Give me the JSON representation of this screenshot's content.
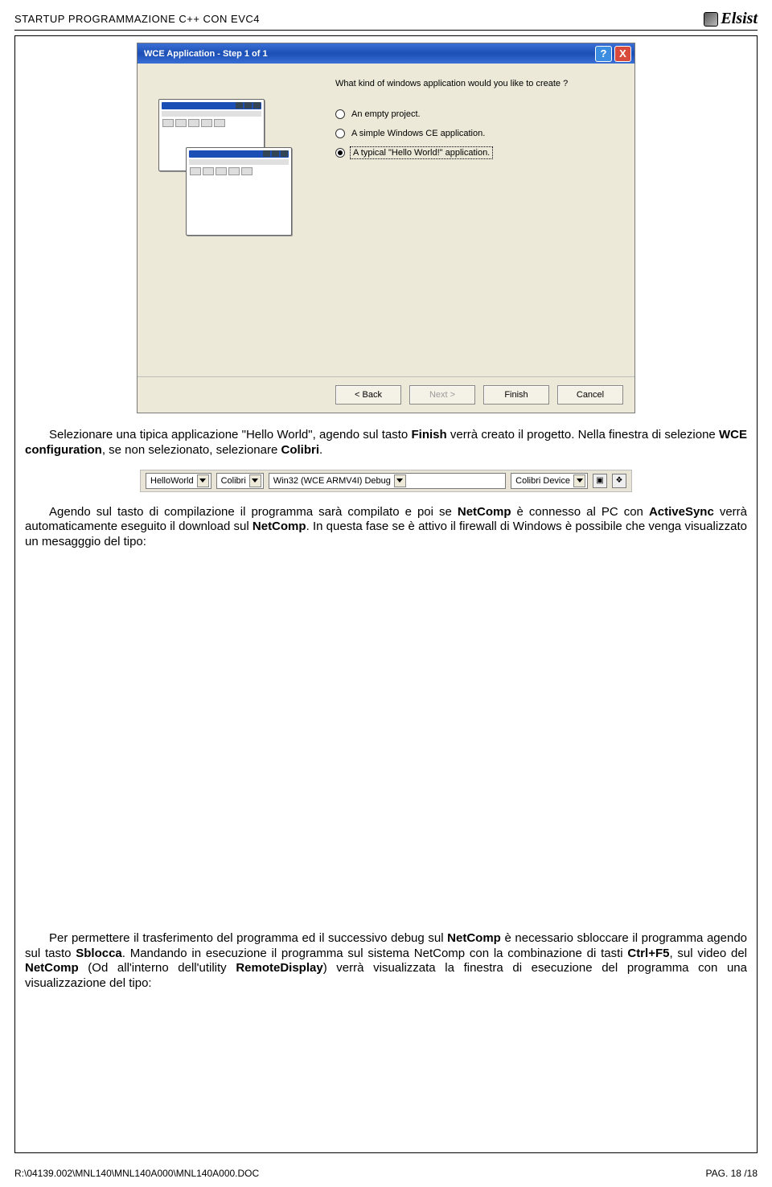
{
  "header": {
    "title": "STARTUP PROGRAMMAZIONE C++ CON EVC4",
    "logo_text": "Elsist"
  },
  "wizard": {
    "title": "WCE Application - Step 1 of 1",
    "prompt": "What kind of windows application would you like to create ?",
    "options": [
      {
        "label": "An empty project.",
        "checked": false
      },
      {
        "label": "A simple Windows CE application.",
        "checked": false
      },
      {
        "label": "A typical \"Hello World!\" application.",
        "checked": true
      }
    ],
    "buttons": {
      "back": "< Back",
      "next": "Next >",
      "finish": "Finish",
      "cancel": "Cancel"
    }
  },
  "para1": {
    "pre1": "Selezionare una tipica applicazione \"Hello World\", agendo sul tasto ",
    "b1": "Finish",
    "mid1": " verrà creato il progetto. Nella finestra di selezione ",
    "b2": "WCE configuration",
    "mid2": ", se non selezionato, selezionare ",
    "b3": "Colibri",
    "tail": "."
  },
  "toolbar": {
    "combo1": "HelloWorld",
    "combo2": "Colibri",
    "combo3": "Win32 (WCE ARMV4I) Debug",
    "combo4": "Colibri Device"
  },
  "para2": {
    "pre": "Agendo sul tasto di compilazione il programma sarà compilato e poi se ",
    "b1": "NetComp",
    "m1": " è connesso al PC con ",
    "b2": "ActiveSync",
    "m2": " verrà automaticamente eseguito il download sul ",
    "b3": "NetComp",
    "m3": ". In questa fase se è attivo il firewall di Windows è possibile che venga visualizzato un mesagggio del tipo:"
  },
  "para3": {
    "pre": "Per permettere il trasferimento del programma ed il successivo debug sul ",
    "b1": "NetComp",
    "m1": " è necessario sbloccare il programma agendo sul tasto ",
    "b2": "Sblocca",
    "m2": ". Mandando in esecuzione il programma sul sistema NetComp con la combinazione di tasti ",
    "b3": "Ctrl+F5",
    "m3": ", sul video del ",
    "b4": "NetComp",
    "m4": " (Od all'interno dell'utility ",
    "b5": "RemoteDisplay",
    "m5": ") verrà visualizzata la finestra di esecuzione del programma con una visualizzazione del tipo:"
  },
  "footer": {
    "path": "R:\\04139.002\\MNL140\\MNL140A000\\MNL140A000.DOC",
    "page": "PAG. 18 /18"
  }
}
